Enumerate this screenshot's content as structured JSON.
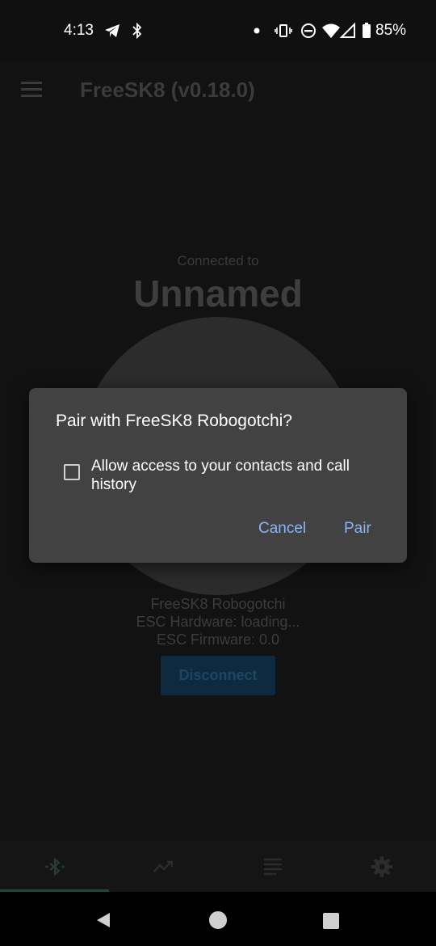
{
  "status_bar": {
    "time": "4:13",
    "battery_percent": "85%",
    "icons": [
      "telegram-icon",
      "bluetooth-icon",
      "dot-icon",
      "vibrate-icon",
      "dnd-icon",
      "wifi-icon",
      "signal-icon",
      "battery-icon"
    ]
  },
  "app_bar": {
    "title": "FreeSK8 (v0.18.0)",
    "menu_icon": "hamburger-menu-icon"
  },
  "main": {
    "connected_label": "Connected to",
    "device_name": "Unnamed",
    "board_name": "FreeSK8 Robogotchi",
    "esc_hardware": "ESC Hardware: loading...",
    "esc_firmware": "ESC Firmware: 0.0",
    "disconnect_label": "Disconnect"
  },
  "bottom_nav": {
    "items": [
      {
        "icon": "bluetooth-icon",
        "active": true
      },
      {
        "icon": "trend-icon",
        "active": false
      },
      {
        "icon": "list-icon",
        "active": false
      },
      {
        "icon": "gear-icon",
        "active": false
      }
    ]
  },
  "dialog": {
    "title": "Pair with FreeSK8 Robogotchi?",
    "checkbox_label": "Allow access to your contacts and call history",
    "checkbox_checked": false,
    "cancel_label": "Cancel",
    "pair_label": "Pair",
    "accent_color": "#8ab4f8"
  },
  "system_nav": {
    "icons": [
      "back-icon",
      "home-icon",
      "recents-icon"
    ]
  }
}
